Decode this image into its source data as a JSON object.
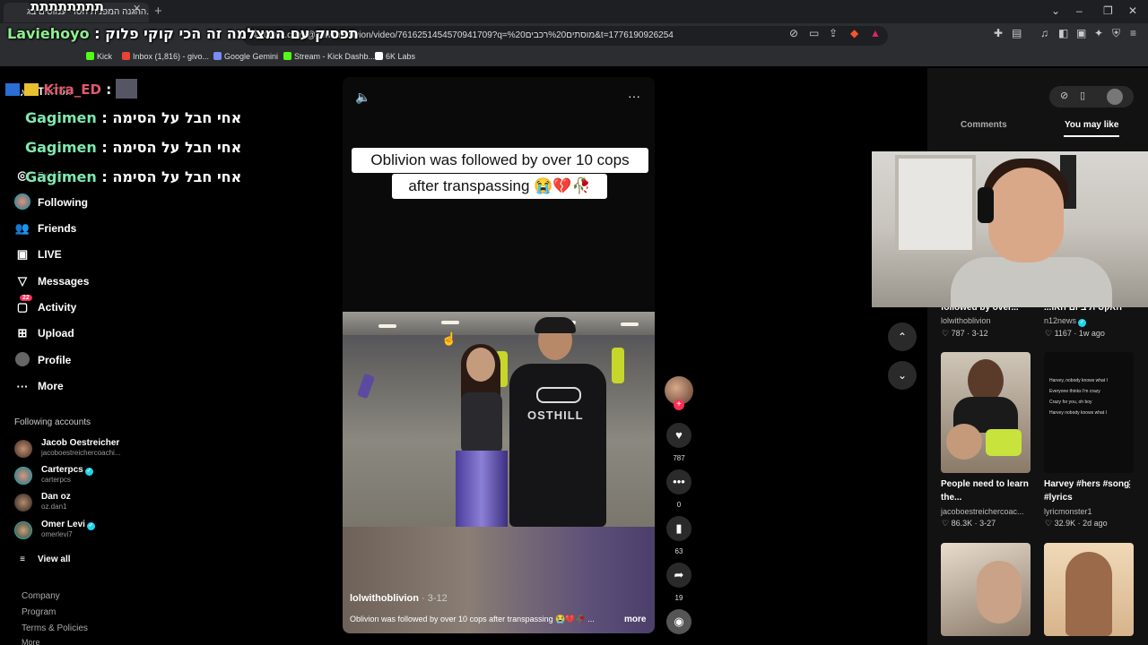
{
  "browser": {
    "tab_title": "ההגנה המפנית חסדי עמוסים בג...",
    "url": "tiktok.com/@lolwithoblivion/video/7616251454570941709?q=%20מוסתים%20רכבים&t=1776190926254",
    "bookmarks": [
      {
        "label": "Kick",
        "color": "#53fc18"
      },
      {
        "label": "Inbox (1,816) - givo...",
        "color": "#ea4335"
      },
      {
        "label": "Google Gemini",
        "color": "#7b8cf5"
      },
      {
        "label": "Stream - Kick Dashb...",
        "color": "#53fc18"
      },
      {
        "label": "6K Labs",
        "color": "#ffffff"
      }
    ]
  },
  "overlay": {
    "top_left_text": "תתתתתתתת",
    "chat": [
      {
        "user": "Laviehoyo",
        "message": "תפסיק עם המצלמה זה הכי קוקי פלוק"
      },
      {
        "user": "Kira_ED",
        "message": ""
      },
      {
        "user": "Gagimen",
        "message": "אחי חבל על הסימה"
      },
      {
        "user": "Gagimen",
        "message": "אחי חבל על הסימה"
      },
      {
        "user": "Gagimen",
        "message": "אחי חבל על הסימה"
      }
    ],
    "colors": {
      "laviehoyo": "#8ff08f",
      "kira": "#e05a6a",
      "gagimen": "#7fe8b0"
    }
  },
  "sidebar": {
    "partial_items": [
      "TikTok",
      "Explore"
    ],
    "items": [
      {
        "label": "Following",
        "icon": "avatar-icon"
      },
      {
        "label": "Friends",
        "icon": "friends-icon"
      },
      {
        "label": "LIVE",
        "icon": "live-icon"
      },
      {
        "label": "Messages",
        "icon": "messages-icon"
      },
      {
        "label": "Activity",
        "icon": "activity-icon",
        "badge": "22"
      },
      {
        "label": "Upload",
        "icon": "upload-icon"
      },
      {
        "label": "Profile",
        "icon": "profile-icon"
      },
      {
        "label": "More",
        "icon": "more-icon"
      }
    ],
    "following_title": "Following accounts",
    "accounts": [
      {
        "name": "Jacob Oestreicher",
        "handle": "jacoboestreichercoachi...",
        "verified": false
      },
      {
        "name": "Carterpcs",
        "handle": "carterpcs",
        "verified": true
      },
      {
        "name": "Dan oz",
        "handle": "oz.dan1",
        "verified": false
      },
      {
        "name": "Omer Levi",
        "handle": "omerlevi7",
        "verified": true
      }
    ],
    "view_all": "View all",
    "footer": [
      "Company",
      "Program",
      "Terms & Policies",
      "More"
    ]
  },
  "video": {
    "caption_line1": "Oblivion was followed by over 10 cops",
    "caption_line2": "after transpassing 😭💔🥀",
    "shirt_text": "OSTHILL",
    "author": "lolwithoblivion",
    "date": " · 3-12",
    "description": "Oblivion was followed by over 10 cops after transpassing 😭💔🥀 ...",
    "more": "more"
  },
  "actions": {
    "likes": "787",
    "comments": "0",
    "saves": "63",
    "shares": "19"
  },
  "right_panel": {
    "tabs": [
      "Comments",
      "You may like"
    ],
    "cards": [
      {
        "title": "followed by over...",
        "author": "lolwithoblivion",
        "meta": "♡ 787 · 3-12"
      },
      {
        "title": "...האקסית ביום האו",
        "author": "n12news",
        "meta": "♡ 1167 · 1w ago"
      },
      {
        "title": "People need to learn the...",
        "author": "jacoboestreichercoac...",
        "meta": "♡ 86.3K · 3-27"
      },
      {
        "title": "Harvey #hers #song #lyrics",
        "author": "lyricmonster1",
        "meta": "♡ 32.9K · 2d ago"
      }
    ],
    "harvey_thumb_text": [
      "Harvey, nobody knows what I",
      "Everyone thinks I'm crazy",
      "Crazy for you, oh boy",
      "Harvey nobody knows what I"
    ]
  }
}
